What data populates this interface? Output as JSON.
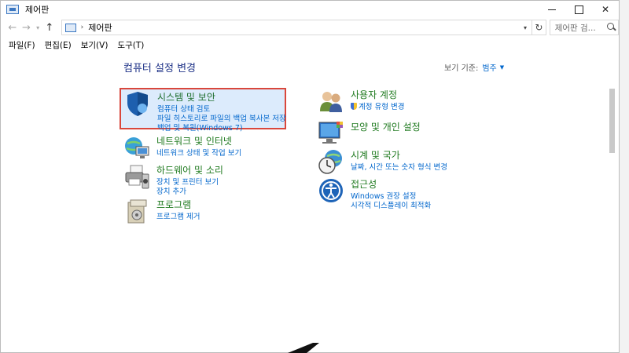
{
  "window": {
    "title": "제어판"
  },
  "address": {
    "path": "제어판",
    "search_placeholder": "제어판 검..."
  },
  "menu": {
    "items": [
      "파일(F)",
      "편집(E)",
      "보기(V)",
      "도구(T)"
    ]
  },
  "main": {
    "title": "컴퓨터 설정 변경",
    "view_by_label": "보기 기준:",
    "view_by_value": "범주"
  },
  "categories": [
    {
      "heading": "시스템 및 보안",
      "links": [
        "컴퓨터 상태 검토",
        "파일 히스토리로 파일의 백업 복사본 저장",
        "백업 및 복원(Windows 7)"
      ]
    },
    {
      "heading": "네트워크 및 인터넷",
      "links": [
        "네트워크 상태 및 작업 보기"
      ]
    },
    {
      "heading": "하드웨어 및 소리",
      "links": [
        "장치 및 프린터 보기",
        "장치 추가"
      ]
    },
    {
      "heading": "프로그램",
      "links": [
        "프로그램 제거"
      ]
    },
    {
      "heading": "사용자 계정",
      "links": [
        "계정 유형 변경"
      ]
    },
    {
      "heading": "모양 및 개인 설정",
      "links": []
    },
    {
      "heading": "시계 및 국가",
      "links": [
        "날짜, 시간 또는 숫자 형식 변경"
      ]
    },
    {
      "heading": "접근성",
      "links": [
        "Windows 권장 설정",
        "시각적 디스플레이 최적화"
      ]
    }
  ]
}
